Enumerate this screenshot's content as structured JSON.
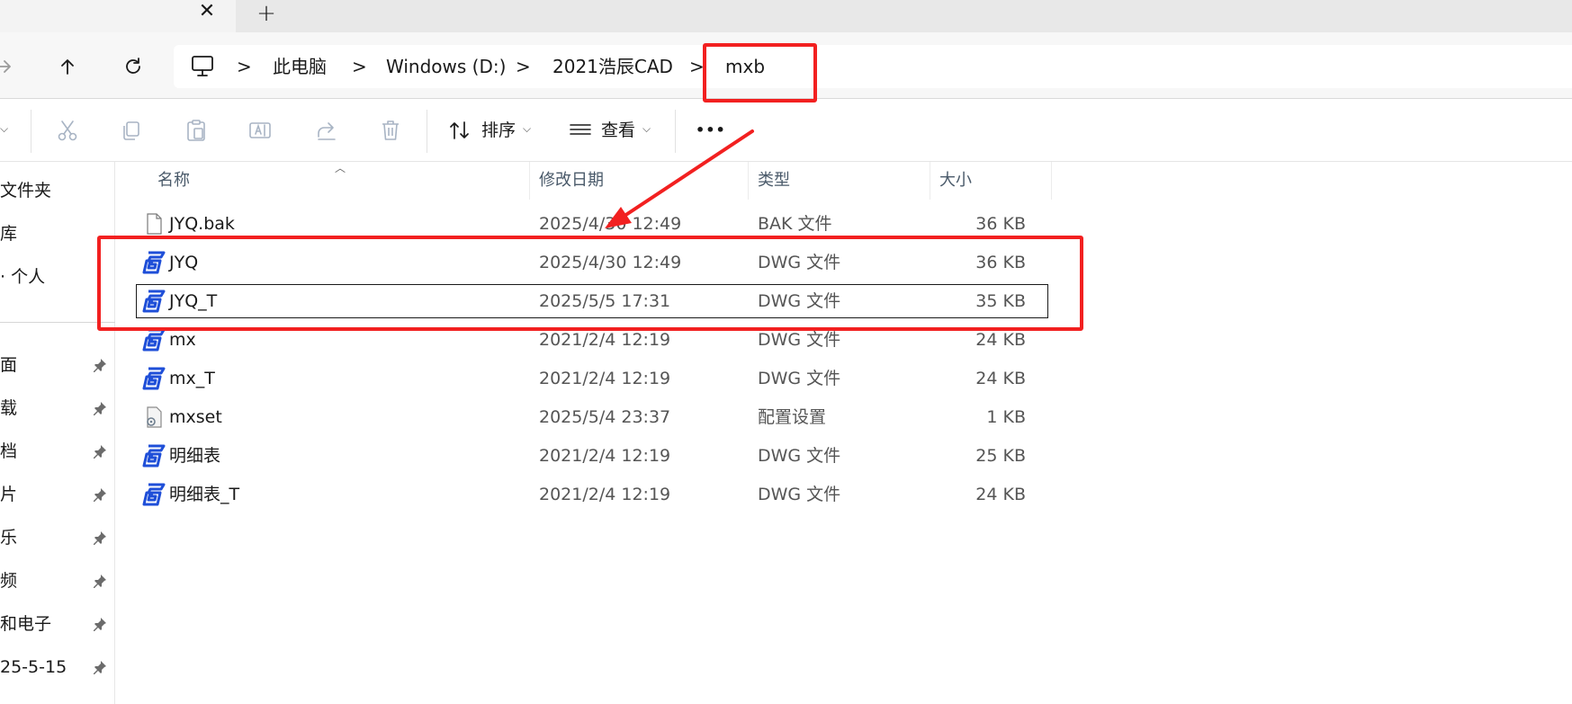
{
  "tab": {
    "close_glyph": "✕",
    "new_glyph": "+"
  },
  "nav": {
    "forward_icon": "arrow-right-icon",
    "up_icon": "arrow-up-icon",
    "refresh_icon": "refresh-icon"
  },
  "address": {
    "root_icon": "computer-icon",
    "crumbs": [
      "此电脑",
      "Windows (D:)",
      "2021浩辰CAD",
      "mxb"
    ],
    "separator": ">"
  },
  "toolbar": {
    "sort_label": "排序",
    "view_label": "查看",
    "more_glyph": "•••",
    "icons": [
      "cut-icon",
      "copy-icon",
      "paste-icon",
      "rename-icon",
      "share-icon",
      "delete-icon"
    ]
  },
  "sidebar": {
    "top_items": [
      "文件夹",
      "库",
      "· 个人"
    ],
    "pinned_items": [
      "面",
      "载",
      "档",
      "片",
      "乐",
      "频",
      "和电子",
      "25-5-15"
    ]
  },
  "columns": {
    "name": "名称",
    "date": "修改日期",
    "type": "类型",
    "size": "大小"
  },
  "files": [
    {
      "name": "JYQ.bak",
      "date": "2025/4/30 12:49",
      "type": "BAK 文件",
      "size": "36 KB",
      "icon": "blank-file-icon"
    },
    {
      "name": "JYQ",
      "date": "2025/4/30 12:49",
      "type": "DWG 文件",
      "size": "36 KB",
      "icon": "gstarcad-dwg-icon"
    },
    {
      "name": "JYQ_T",
      "date": "2025/5/5 17:31",
      "type": "DWG 文件",
      "size": "35 KB",
      "icon": "gstarcad-dwg-icon"
    },
    {
      "name": "mx",
      "date": "2021/2/4 12:19",
      "type": "DWG 文件",
      "size": "24 KB",
      "icon": "gstarcad-dwg-icon"
    },
    {
      "name": "mx_T",
      "date": "2021/2/4 12:19",
      "type": "DWG 文件",
      "size": "24 KB",
      "icon": "gstarcad-dwg-icon"
    },
    {
      "name": "mxset",
      "date": "2025/5/4 23:37",
      "type": "配置设置",
      "size": "1 KB",
      "icon": "settings-file-icon"
    },
    {
      "name": "明细表",
      "date": "2021/2/4 12:19",
      "type": "DWG 文件",
      "size": "25 KB",
      "icon": "gstarcad-dwg-icon"
    },
    {
      "name": "明细表_T",
      "date": "2021/2/4 12:19",
      "type": "DWG 文件",
      "size": "24 KB",
      "icon": "gstarcad-dwg-icon"
    }
  ],
  "colors": {
    "annotation": "#f22020",
    "dwg_icon": "#1f4fd8"
  }
}
